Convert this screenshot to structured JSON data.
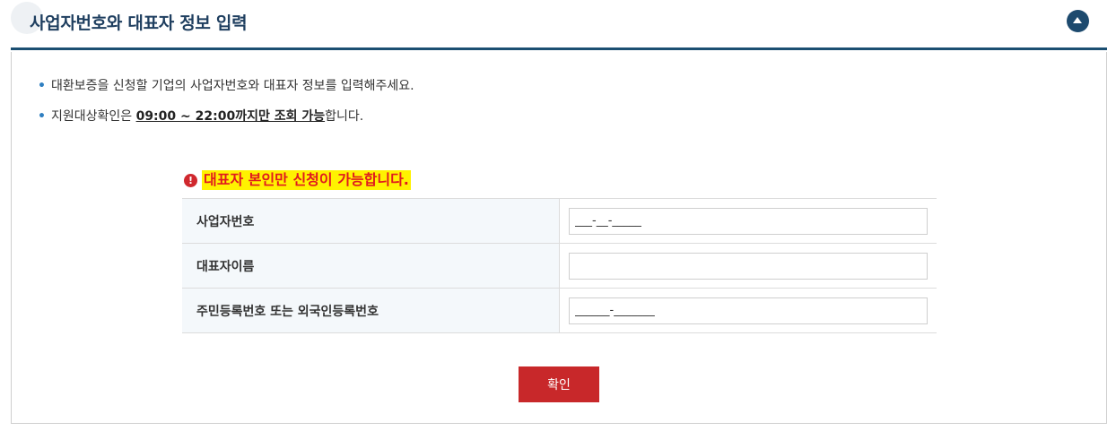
{
  "header": {
    "title": "사업자번호와 대표자 정보 입력",
    "collapse_icon": "chevron-up-icon"
  },
  "notices": [
    {
      "text": "대환보증을 신청할 기업의 사업자번호와 대표자 정보를 입력해주세요."
    },
    {
      "prefix": "지원대상확인은 ",
      "emphasis": "09:00 ~ 22:00까지만 조회 가능",
      "suffix": "합니다."
    }
  ],
  "warning": {
    "icon": "exclamation-circle-icon",
    "text": "대표자 본인만 신청이 가능합니다."
  },
  "form": {
    "fields": [
      {
        "label": "사업자번호",
        "placeholder": "___-__-_____",
        "value": ""
      },
      {
        "label": "대표자이름",
        "placeholder": "",
        "value": ""
      },
      {
        "label": "주민등록번호 또는 외국인등록번호",
        "placeholder": "______-_______",
        "value": ""
      }
    ]
  },
  "actions": {
    "confirm_label": "확인"
  },
  "colors": {
    "header_border": "#1b4f72",
    "title": "#1e3e5f",
    "warning_bg": "#fff200",
    "warning_text": "#e0191f",
    "confirm_button": "#c8282a"
  }
}
